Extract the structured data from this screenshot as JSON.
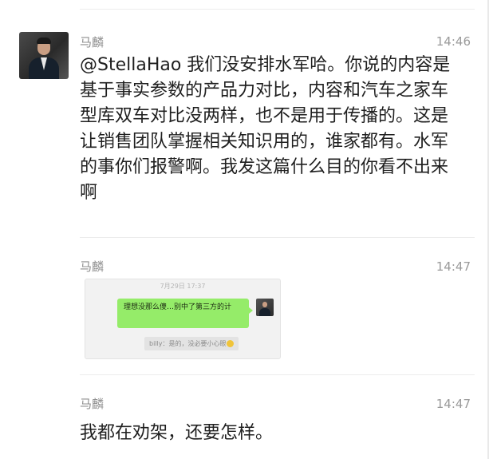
{
  "messages": [
    {
      "sender": "马麟",
      "time": "14:46",
      "text": "@StellaHao 我们没安排水军哈。你说的内容是基于事实参数的产品力对比，内容和汽车之家车型库双车对比没两样，也不是用于传播的。这是让销售团队掌握相关知识用的，谁家都有。水军的事你们报警啊。我发这篇什么目的你看不出来啊"
    },
    {
      "sender": "马麟",
      "time": "14:47",
      "image": {
        "date": "7月29日 17:37",
        "bubble_text": "理想没那么傻…别中了第三方的计",
        "quote_text": "billy：是的，没必要小心眼"
      }
    },
    {
      "sender": "马麟",
      "time": "14:47",
      "text": "我都在劝架，还要怎样。"
    }
  ]
}
